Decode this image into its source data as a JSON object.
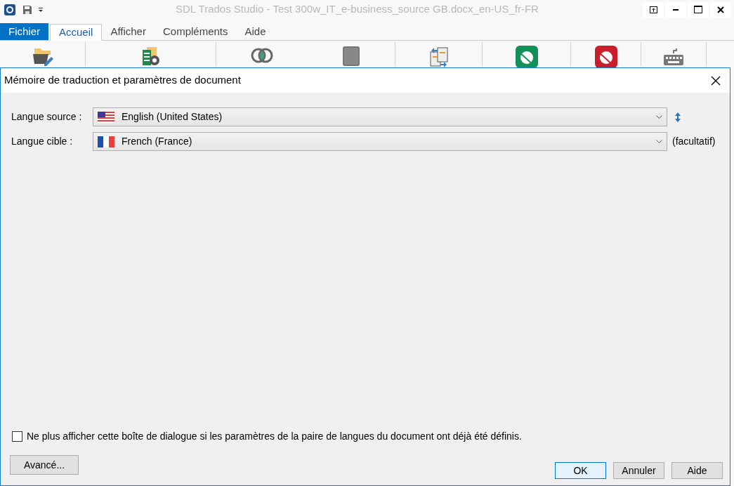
{
  "window": {
    "title": "SDL Trados Studio - Test 300w_IT_e-business_source GB.docx_en-US_fr-FR"
  },
  "ribbon_tabs": [
    {
      "label": "Fichier",
      "kind": "file",
      "selected": false
    },
    {
      "label": "Accueil",
      "kind": "tab",
      "selected": true
    },
    {
      "label": "Afficher",
      "kind": "tab",
      "selected": false
    },
    {
      "label": "Compléments",
      "kind": "tab",
      "selected": false
    },
    {
      "label": "Aide",
      "kind": "tab",
      "selected": false
    }
  ],
  "dialog": {
    "title": "Mémoire de traduction et paramètres de document",
    "fields": [
      {
        "label": "Langue source :",
        "value": "English (United States)",
        "kind": "source"
      },
      {
        "label": "Langue cible :",
        "value": "French (France)",
        "kind": "target",
        "suffix": "(facultatif)"
      }
    ],
    "checkbox": {
      "label": "Ne plus afficher cette boîte de dialogue si les paramètres de la paire de langues du document ont déjà été définis.",
      "checked": false
    },
    "advanced_button": "Avancé...",
    "buttons": [
      {
        "label": "OK",
        "default": true
      },
      {
        "label": "Annuler",
        "default": false
      },
      {
        "label": "Aide",
        "default": false
      }
    ]
  }
}
